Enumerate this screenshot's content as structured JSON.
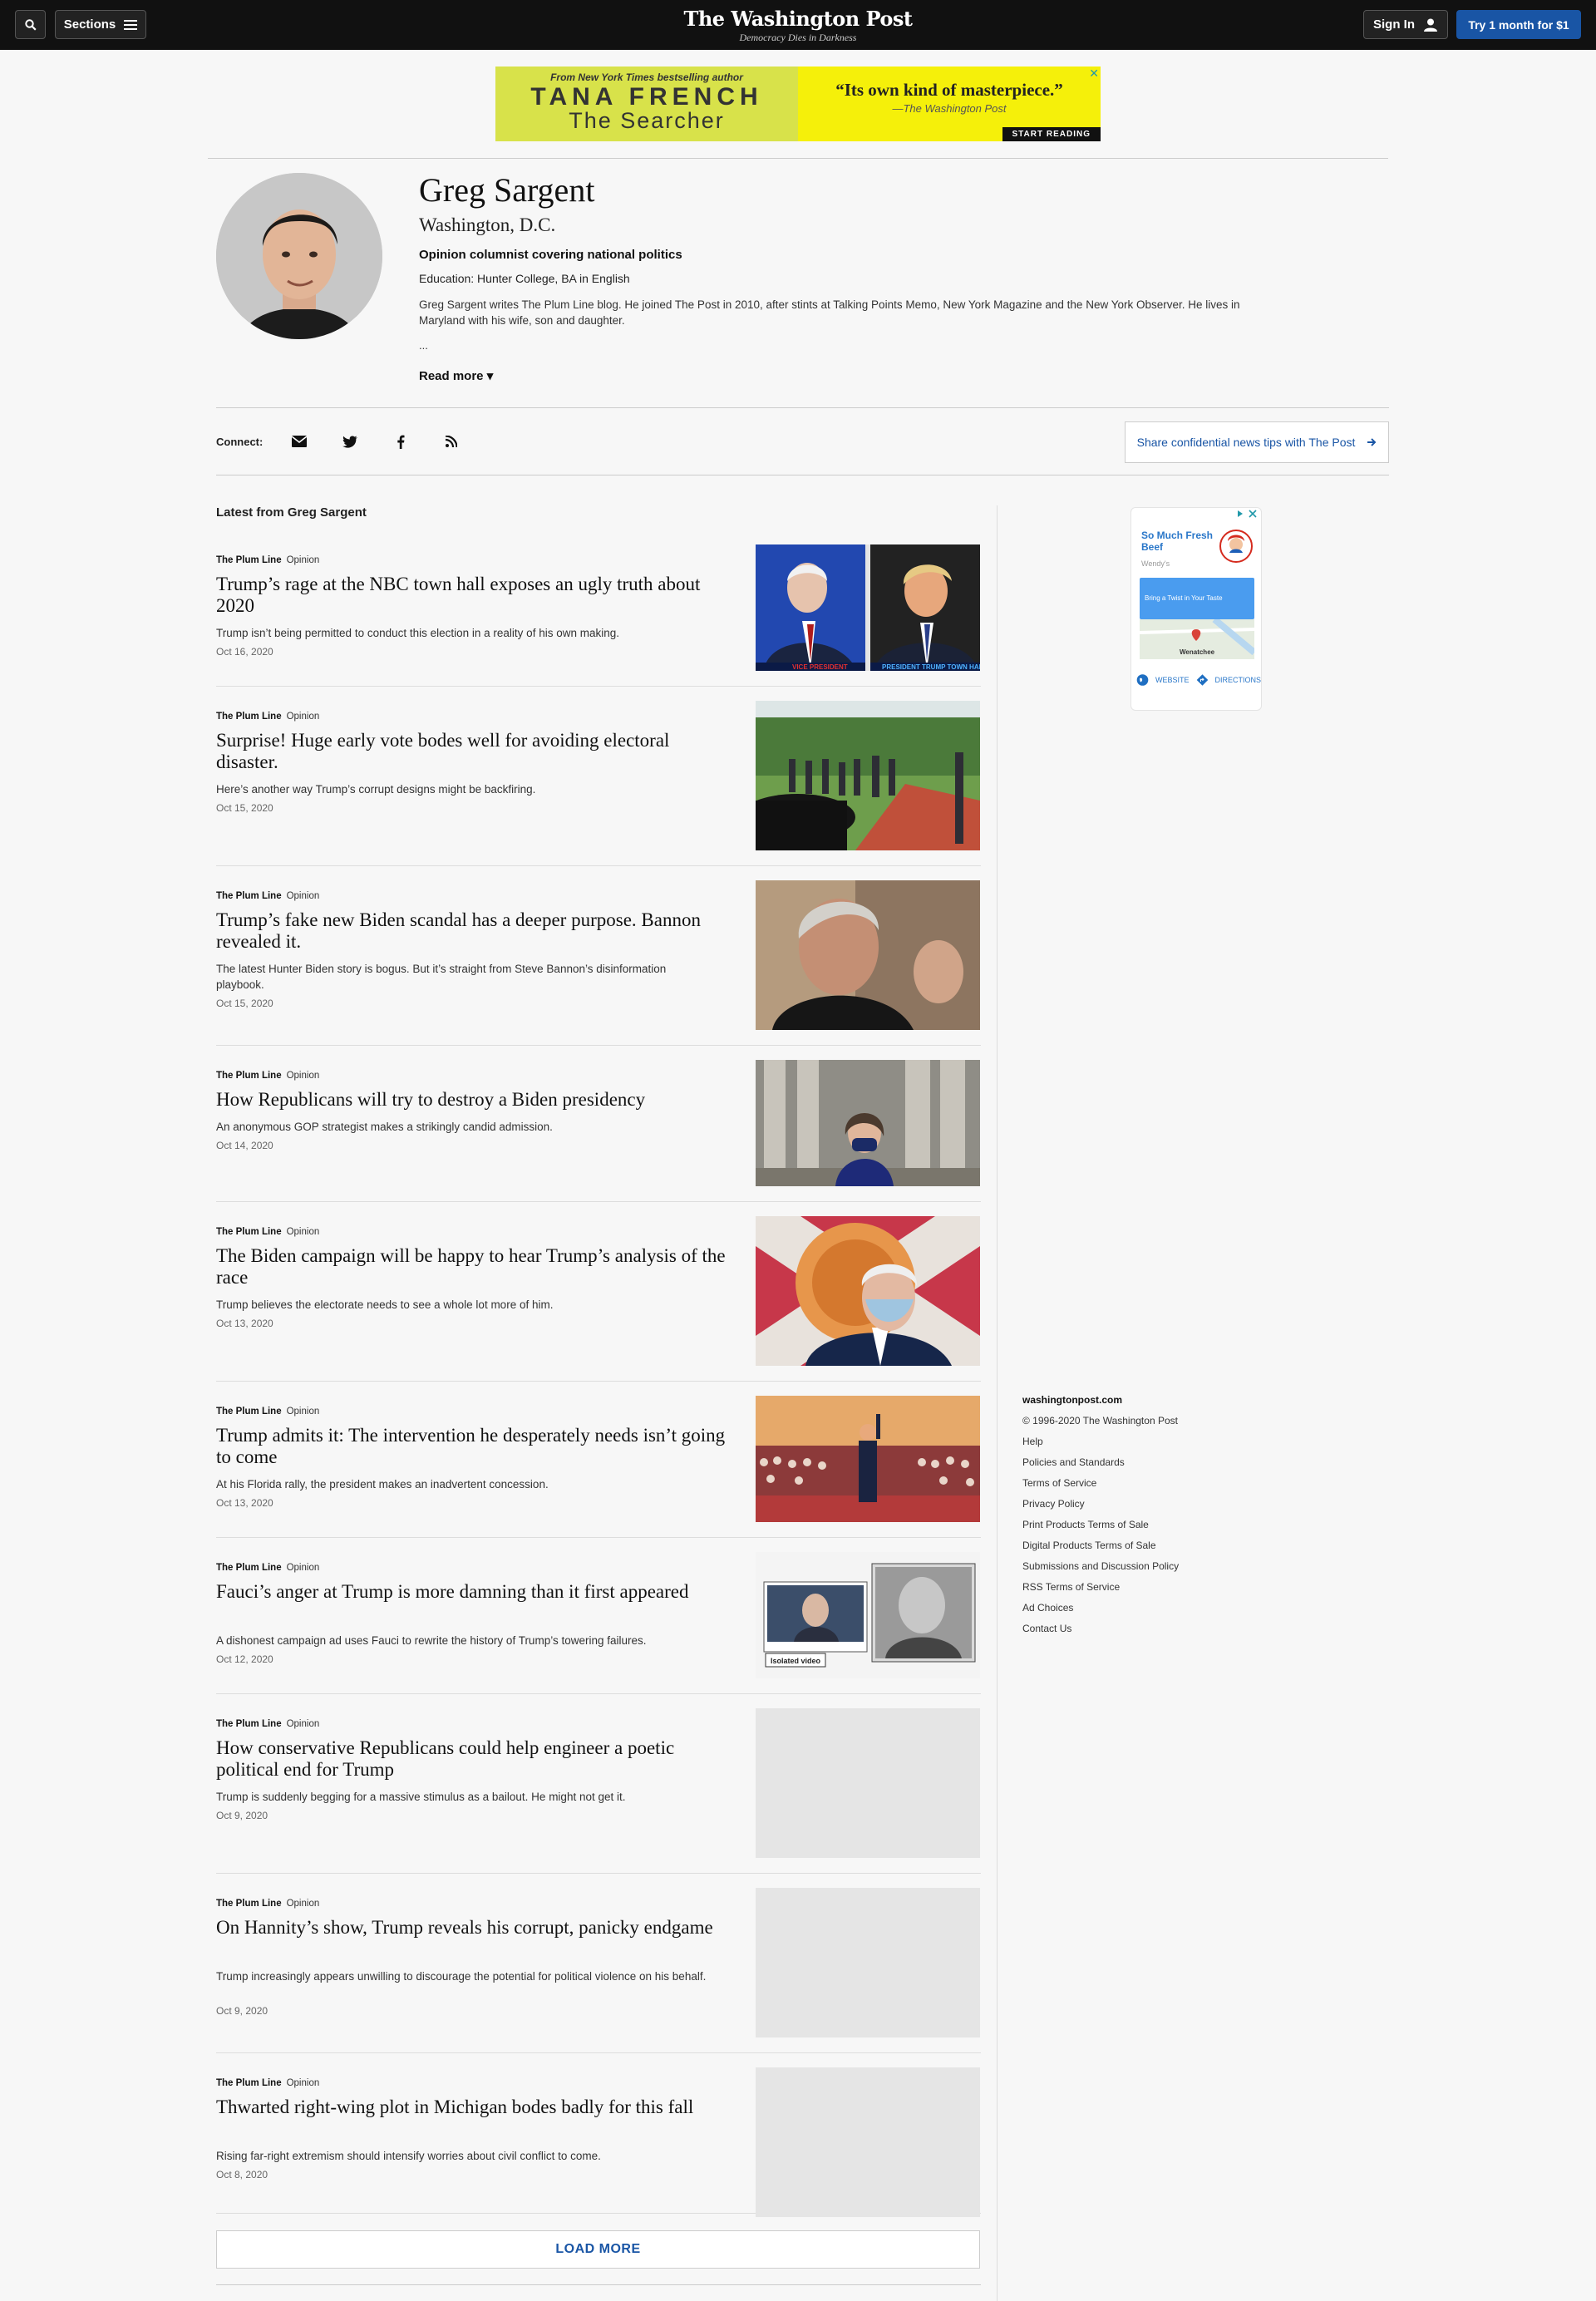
{
  "nav": {
    "sections_label": "Sections",
    "logo": "The Washington Post",
    "tagline": "Democracy Dies in Darkness",
    "signin_label": "Sign In",
    "try_label": "Try 1 month for $1"
  },
  "ad_banner": {
    "from": "From New York Times bestselling author",
    "author": "TANA FRENCH",
    "book": "The Searcher",
    "quote": "“Its own kind of masterpiece.”",
    "quote_source": "—The Washington Post",
    "cta": "START READING",
    "close": "✕"
  },
  "profile": {
    "name": "Greg Sargent",
    "location": "Washington, D.C.",
    "role": "Opinion columnist covering national politics",
    "education": "Education: Hunter College, BA in English",
    "bio": "Greg Sargent writes The Plum Line blog. He joined The Post in 2010, after stints at Talking Points Memo, New York Magazine and the New York Observer. He lives in Maryland with his wife, son and daughter.",
    "ellipsis": "...",
    "read_more": "Read more ▾"
  },
  "connect": {
    "label": "Connect:",
    "icons": [
      "email-icon",
      "twitter-icon",
      "facebook-icon",
      "rss-icon"
    ],
    "tips_label": "Share confidential news tips with The Post"
  },
  "latest_label": "Latest from Greg Sargent",
  "articles": [
    {
      "kicker": "The Plum Line",
      "tag": "Opinion",
      "headline": "Trump’s rage at the NBC town hall exposes an ugly truth about 2020",
      "blurb": "Trump isn’t being permitted to conduct this election in a reality of his own making.",
      "date": "Oct 16, 2020"
    },
    {
      "kicker": "The Plum Line",
      "tag": "Opinion",
      "headline": "Surprise! Huge early vote bodes well for avoiding electoral disaster.",
      "blurb": "Here’s another way Trump’s corrupt designs might be backfiring.",
      "date": "Oct 15, 2020"
    },
    {
      "kicker": "The Plum Line",
      "tag": "Opinion",
      "headline": "Trump’s fake new Biden scandal has a deeper purpose. Bannon revealed it.",
      "blurb": "The latest Hunter Biden story is bogus. But it’s straight from Steve Bannon’s disinformation playbook.",
      "date": "Oct 15, 2020"
    },
    {
      "kicker": "The Plum Line",
      "tag": "Opinion",
      "headline": "How Republicans will try to destroy a Biden presidency",
      "blurb": "An anonymous GOP strategist makes a strikingly candid admission.",
      "date": "Oct 14, 2020"
    },
    {
      "kicker": "The Plum Line",
      "tag": "Opinion",
      "headline": "The Biden campaign will be happy to hear Trump’s analysis of the race",
      "blurb": "Trump believes the electorate needs to see a whole lot more of him.",
      "date": "Oct 13, 2020"
    },
    {
      "kicker": "The Plum Line",
      "tag": "Opinion",
      "headline": "Trump admits it: The intervention he desperately needs isn’t going to come",
      "blurb": "At his Florida rally, the president makes an inadvertent concession.",
      "date": "Oct 13, 2020"
    },
    {
      "kicker": "The Plum Line",
      "tag": "Opinion",
      "headline": "Fauci’s anger at Trump is more damning than it first appeared",
      "blurb": "A dishonest campaign ad uses Fauci to rewrite the history of Trump’s towering failures.",
      "date": "Oct 12, 2020"
    },
    {
      "kicker": "The Plum Line",
      "tag": "Opinion",
      "headline": "How conservative Republicans could help engineer a poetic political end for Trump",
      "blurb": "Trump is suddenly begging for a massive stimulus as a bailout. He might not get it.",
      "date": "Oct 9, 2020"
    },
    {
      "kicker": "The Plum Line",
      "tag": "Opinion",
      "headline": "On Hannity’s show, Trump reveals his corrupt, panicky endgame",
      "blurb": "Trump increasingly appears unwilling to discourage the potential for political violence on his behalf.",
      "date": "Oct 9, 2020"
    },
    {
      "kicker": "The Plum Line",
      "tag": "Opinion",
      "headline": "Thwarted right-wing plot in Michigan bodes badly for this fall",
      "blurb": "Rising far-right extremism should intensify worries about civil conflict to come.",
      "date": "Oct 8, 2020"
    }
  ],
  "image_captions": {
    "biden_town_hall": "VICE PRESIDENT",
    "trump_town_hall": "PRESIDENT TRUMP TOWN HALL",
    "isolated_video": "Isolated video"
  },
  "load_more": "LOAD MORE",
  "side_ad": {
    "title": "So Much Fresh Beef",
    "brand": "Wendy's",
    "cta": "Bring a Twist in Your Taste",
    "place": "Wenatchee",
    "website": "WEBSITE",
    "directions": "DIRECTIONS"
  },
  "footer": {
    "site": "washingtonpost.com",
    "copyright": "© 1996-2020 The Washington Post",
    "links": [
      "Help",
      "Policies and Standards",
      "Terms of Service",
      "Privacy Policy",
      "Print Products Terms of Sale",
      "Digital Products Terms of Sale",
      "Submissions and Discussion Policy",
      "RSS Terms of Service",
      "Ad Choices",
      "Contact Us"
    ]
  },
  "colors": {
    "nav_bg": "#111111",
    "accent_blue": "#1955a5",
    "page_bg": "#f7f7f7"
  }
}
